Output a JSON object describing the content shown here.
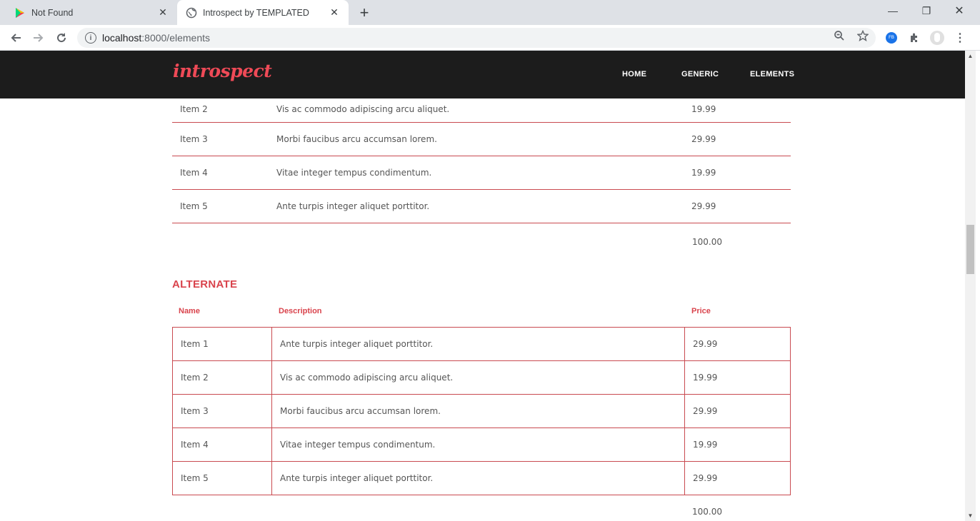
{
  "browser": {
    "tabs": [
      {
        "title": "Not Found",
        "active": false
      },
      {
        "title": "Introspect by TEMPLATED",
        "active": true
      }
    ],
    "url_host": "localhost",
    "url_rest": ":8000/elements",
    "profile_badge": "FB"
  },
  "site": {
    "logo": "introspect",
    "nav": [
      "HOME",
      "GENERIC",
      "ELEMENTS"
    ]
  },
  "default_table": {
    "rows": [
      {
        "name": "Item 2",
        "description": "Vis ac commodo adipiscing arcu aliquet.",
        "price": "19.99"
      },
      {
        "name": "Item 3",
        "description": "Morbi faucibus arcu accumsan lorem.",
        "price": "29.99"
      },
      {
        "name": "Item 4",
        "description": "Vitae integer tempus condimentum.",
        "price": "19.99"
      },
      {
        "name": "Item 5",
        "description": "Ante turpis integer aliquet porttitor.",
        "price": "29.99"
      }
    ],
    "total": "100.00"
  },
  "alternate_table": {
    "title": "ALTERNATE",
    "headers": [
      "Name",
      "Description",
      "Price"
    ],
    "rows": [
      {
        "name": "Item 1",
        "description": "Ante turpis integer aliquet porttitor.",
        "price": "29.99"
      },
      {
        "name": "Item 2",
        "description": "Vis ac commodo adipiscing arcu aliquet.",
        "price": "19.99"
      },
      {
        "name": "Item 3",
        "description": "Morbi faucibus arcu accumsan lorem.",
        "price": "29.99"
      },
      {
        "name": "Item 4",
        "description": "Vitae integer tempus condimentum.",
        "price": "19.99"
      },
      {
        "name": "Item 5",
        "description": "Ante turpis integer aliquet porttitor.",
        "price": "29.99"
      }
    ],
    "total": "100.00"
  },
  "colors": {
    "accent": "#d9434c",
    "header_bg": "#1c1c1c",
    "table_border": "#c94a50"
  }
}
